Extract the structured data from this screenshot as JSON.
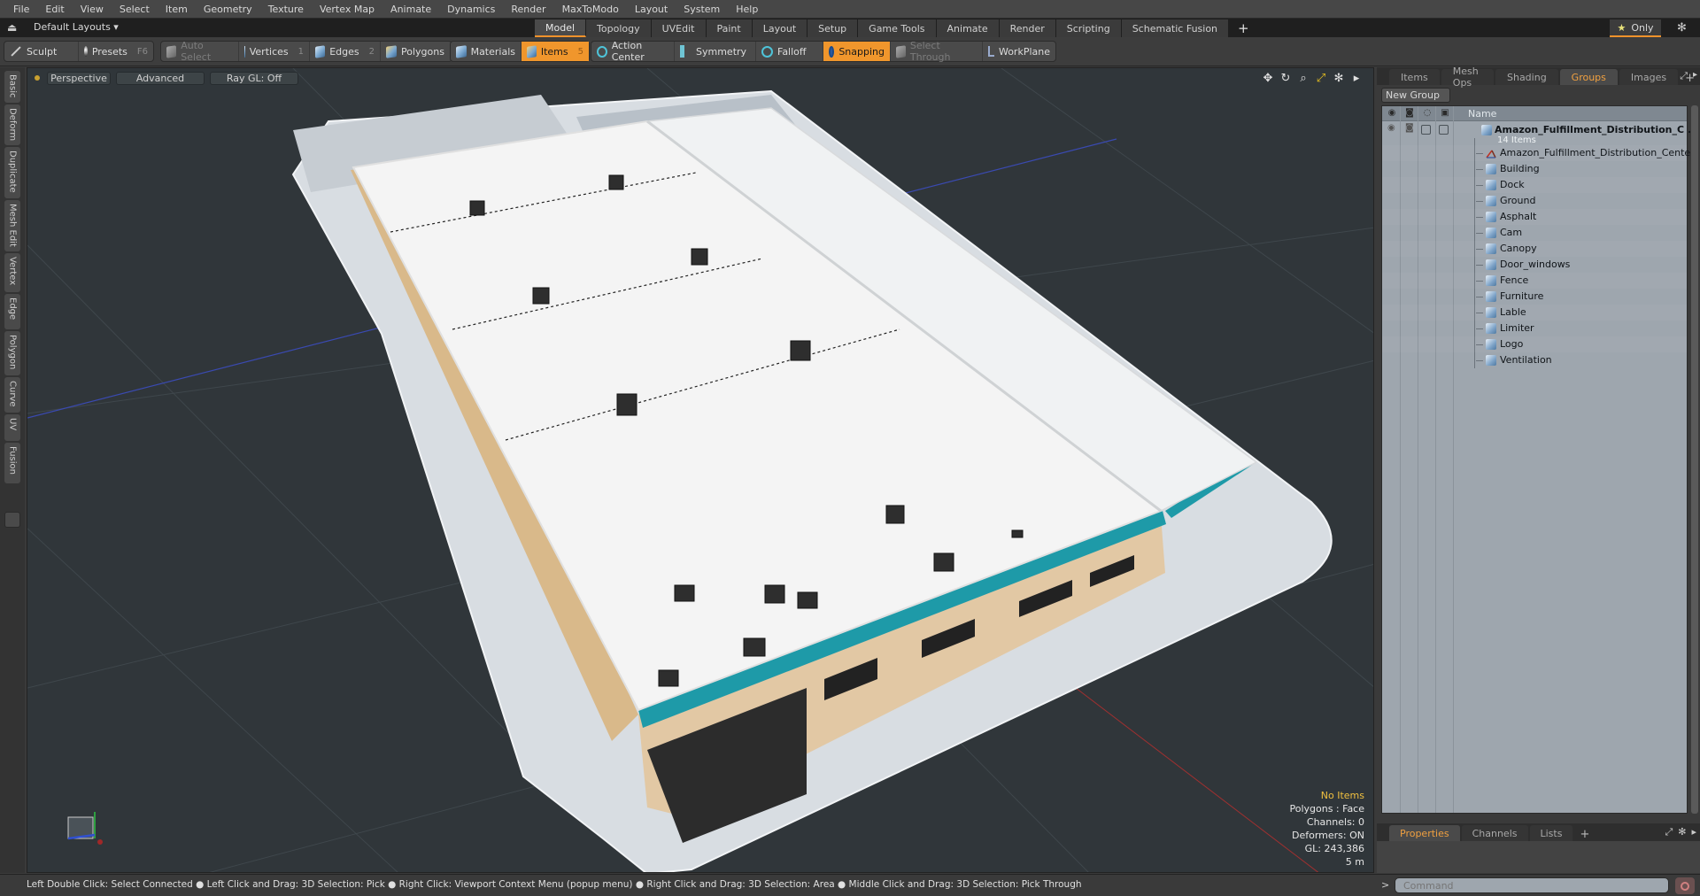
{
  "menu": [
    "File",
    "Edit",
    "View",
    "Select",
    "Item",
    "Geometry",
    "Texture",
    "Vertex Map",
    "Animate",
    "Dynamics",
    "Render",
    "MaxToModo",
    "Layout",
    "System",
    "Help"
  ],
  "layout_row": {
    "layout_selector": "Default Layouts ▾",
    "tabs": [
      {
        "label": "Model",
        "active": true
      },
      {
        "label": "Topology"
      },
      {
        "label": "UVEdit"
      },
      {
        "label": "Paint"
      },
      {
        "label": "Layout"
      },
      {
        "label": "Setup"
      },
      {
        "label": "Game Tools"
      },
      {
        "label": "Animate"
      },
      {
        "label": "Render"
      },
      {
        "label": "Scripting"
      },
      {
        "label": "Schematic Fusion"
      }
    ],
    "add_tab": "+",
    "only_label": "Only",
    "star_icon": "★",
    "gear_icon": "✻"
  },
  "toolbar": {
    "sculpt": "Sculpt",
    "presets": "Presets",
    "presets_key": "F6",
    "auto_select": "Auto Select",
    "vertices": "Vertices",
    "vertices_key": "1",
    "edges": "Edges",
    "edges_key": "2",
    "polygons": "Polygons",
    "materials": "Materials",
    "items": "Items",
    "items_key": "5",
    "action_center": "Action Center",
    "symmetry": "Symmetry",
    "falloff": "Falloff",
    "snapping": "Snapping",
    "select_through": "Select Through",
    "workplane": "WorkPlane"
  },
  "left_tabs": [
    "Basic",
    "Deform",
    "Duplicate",
    "Mesh Edit",
    "Vertex",
    "Edge",
    "Polygon",
    "Curve",
    "UV",
    "Fusion"
  ],
  "viewport": {
    "view_mode": "Perspective",
    "shading": "Advanced",
    "raygl": "Ray GL: Off",
    "icons": {
      "move": "✥",
      "rotate": "↻",
      "zoom": "⌕",
      "fit": "⤢",
      "settings": "✻",
      "more": "▸"
    },
    "info": {
      "selection": "No Items",
      "polygons": "Polygons : Face",
      "channels": "Channels: 0",
      "deformers": "Deformers: ON",
      "gl": "GL: 243,386",
      "scale": "5 m"
    },
    "colors": {
      "background": "#30363a",
      "accent_teal": "#1e9aa8",
      "roof": "#f4f4f4",
      "facade": "#e2c8a4"
    }
  },
  "right_panel": {
    "tabs": [
      {
        "label": "Items"
      },
      {
        "label": "Mesh Ops"
      },
      {
        "label": "Shading"
      },
      {
        "label": "Groups",
        "active": true
      },
      {
        "label": "Images"
      }
    ],
    "new_group": "New Group",
    "column_name": "Name",
    "root": {
      "name": "Amazon_Fulfillment_Distribution_C ...",
      "count": "14 Items"
    },
    "items": [
      {
        "name": "Amazon_Fulfillment_Distribution_Center",
        "type": "locator"
      },
      {
        "name": "Building",
        "type": "mesh"
      },
      {
        "name": "Dock",
        "type": "mesh"
      },
      {
        "name": "Ground",
        "type": "mesh"
      },
      {
        "name": "Asphalt",
        "type": "mesh"
      },
      {
        "name": "Cam",
        "type": "mesh"
      },
      {
        "name": "Canopy",
        "type": "mesh"
      },
      {
        "name": "Door_windows",
        "type": "mesh"
      },
      {
        "name": "Fence",
        "type": "mesh"
      },
      {
        "name": "Furniture",
        "type": "mesh"
      },
      {
        "name": "Lable",
        "type": "mesh"
      },
      {
        "name": "Limiter",
        "type": "mesh"
      },
      {
        "name": "Logo",
        "type": "mesh"
      },
      {
        "name": "Ventilation",
        "type": "mesh"
      }
    ],
    "bottom_tabs": [
      {
        "label": "Properties",
        "active": true
      },
      {
        "label": "Channels"
      },
      {
        "label": "Lists"
      }
    ]
  },
  "status_bar": {
    "hint": "Left Double Click: Select Connected ● Left Click and Drag: 3D Selection: Pick ● Right Click: Viewport Context Menu (popup menu) ● Right Click and Drag: 3D Selection: Area ● Middle Click and Drag: 3D Selection: Pick Through"
  },
  "command": {
    "prompt": ">",
    "placeholder": "Command"
  }
}
